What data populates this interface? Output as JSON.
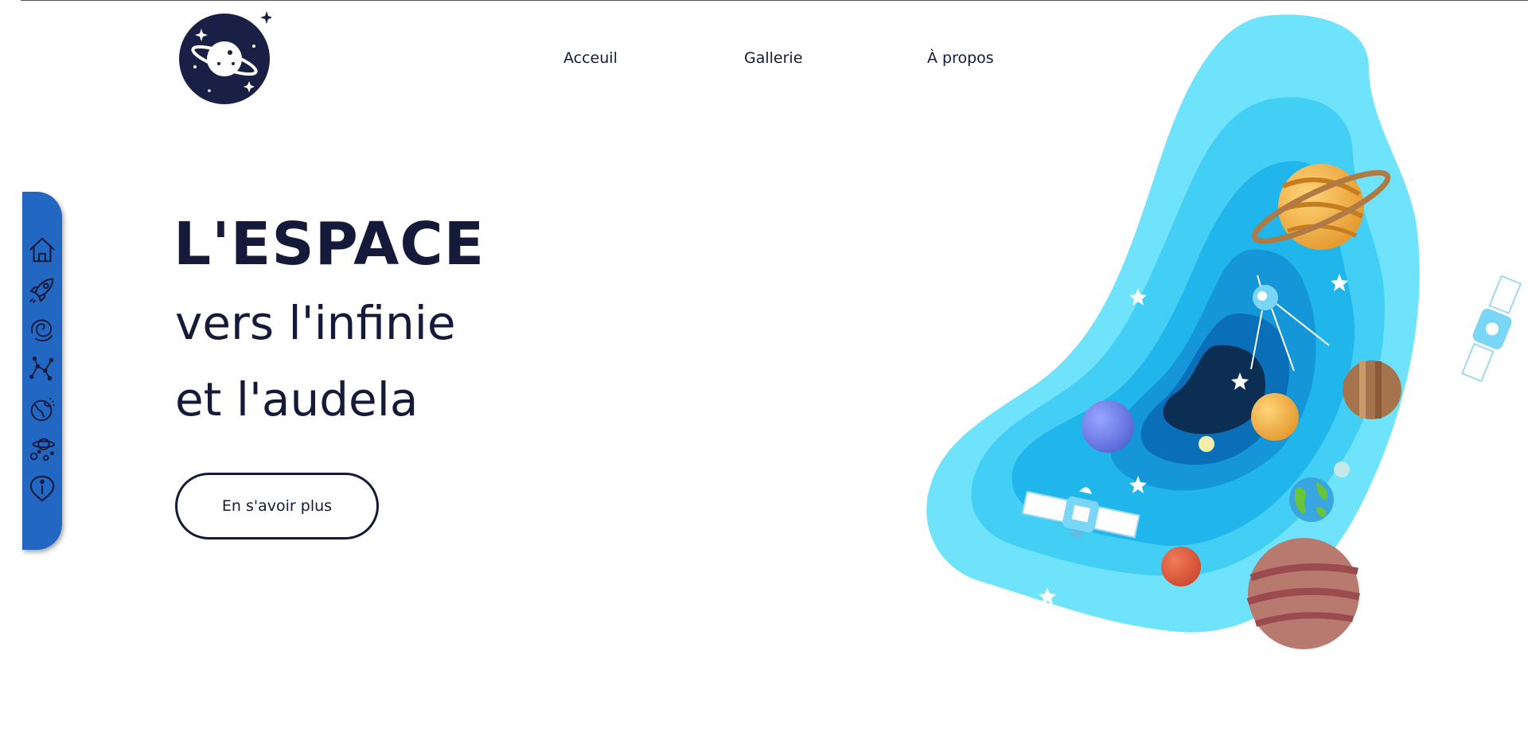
{
  "header": {
    "logo_icon": "planet-logo-icon",
    "nav": [
      {
        "label": "Acceuil"
      },
      {
        "label": "Gallerie"
      },
      {
        "label": "À propos"
      }
    ]
  },
  "sidebar": {
    "color": "#2268c2",
    "items": [
      {
        "icon": "home-icon"
      },
      {
        "icon": "rocket-icon"
      },
      {
        "icon": "galaxy-icon"
      },
      {
        "icon": "constellation-icon"
      },
      {
        "icon": "earth-icon"
      },
      {
        "icon": "planets-icon"
      },
      {
        "icon": "info-icon"
      }
    ]
  },
  "hero": {
    "line1": "L'ESPACE",
    "line2": "vers l'infinie",
    "line3": "et l'audela",
    "cta_label": "En s'avoir plus"
  },
  "colors": {
    "text": "#15193a",
    "accent_blue": "#2268c2",
    "sky_light": "#6fe3fb"
  }
}
